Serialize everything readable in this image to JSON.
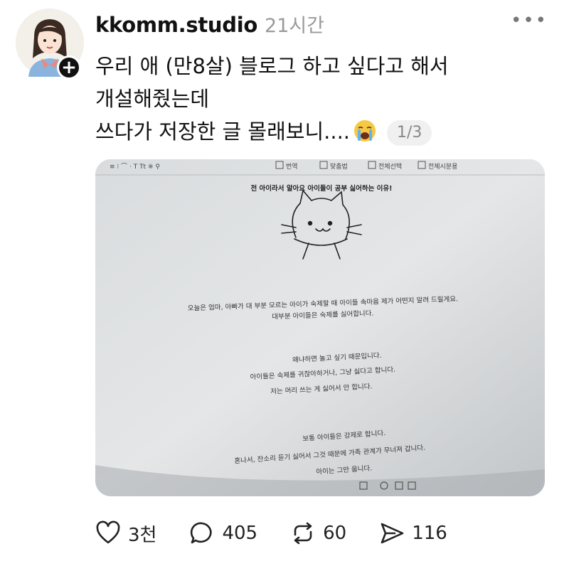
{
  "post": {
    "username": "kkomm.studio",
    "timestamp": "21시간",
    "more_label": "•••",
    "follow_label": "+",
    "lines": [
      "우리 애 (만8살) 블로그 하고 싶다고 해서",
      "개설해줬는데",
      "쓰다가 저장한 글 몰래보니...."
    ],
    "image_counter": "1/3"
  },
  "photo": {
    "toolbar_items": [
      "번역",
      "맞춤법",
      "전체선택",
      "전체시분용"
    ],
    "title": "전 아이라서 알아요 아이들이 공부 싫어하는 이유!",
    "paragraphs": [
      [
        "오늘은 엄마, 아빠가 대 부분 모르는 아이가 숙제할 때 아이들 속마음 제가 어떤지 알려 드릴게요.",
        "대부분 아이들은 숙제를 싫어합니다."
      ],
      [
        "왜냐하면 놀고 싶기 때문입니다.",
        "아이들은 숙제를 귀찮아하거나, 그냥 싫다고 합니다.",
        "저는 머리 쓰는 게 싫어서 안 합니다."
      ],
      [
        "보통 아이들은 강제로 합니다.",
        "혼나서, 잔소리 듣기 싫어서 그것 때문에 가족 관계가 무너져 갑니다.",
        "아이는 그만 웁니다."
      ]
    ]
  },
  "actions": {
    "likes": "3천",
    "comments": "405",
    "reposts": "60",
    "shares": "116"
  },
  "icons": [
    "heart-icon",
    "comment-icon",
    "repost-icon",
    "share-icon",
    "crying-emoji-icon"
  ],
  "colors": {
    "text": "#111111",
    "muted": "#9a9a9a",
    "counter_bg": "#f0f0f0"
  }
}
